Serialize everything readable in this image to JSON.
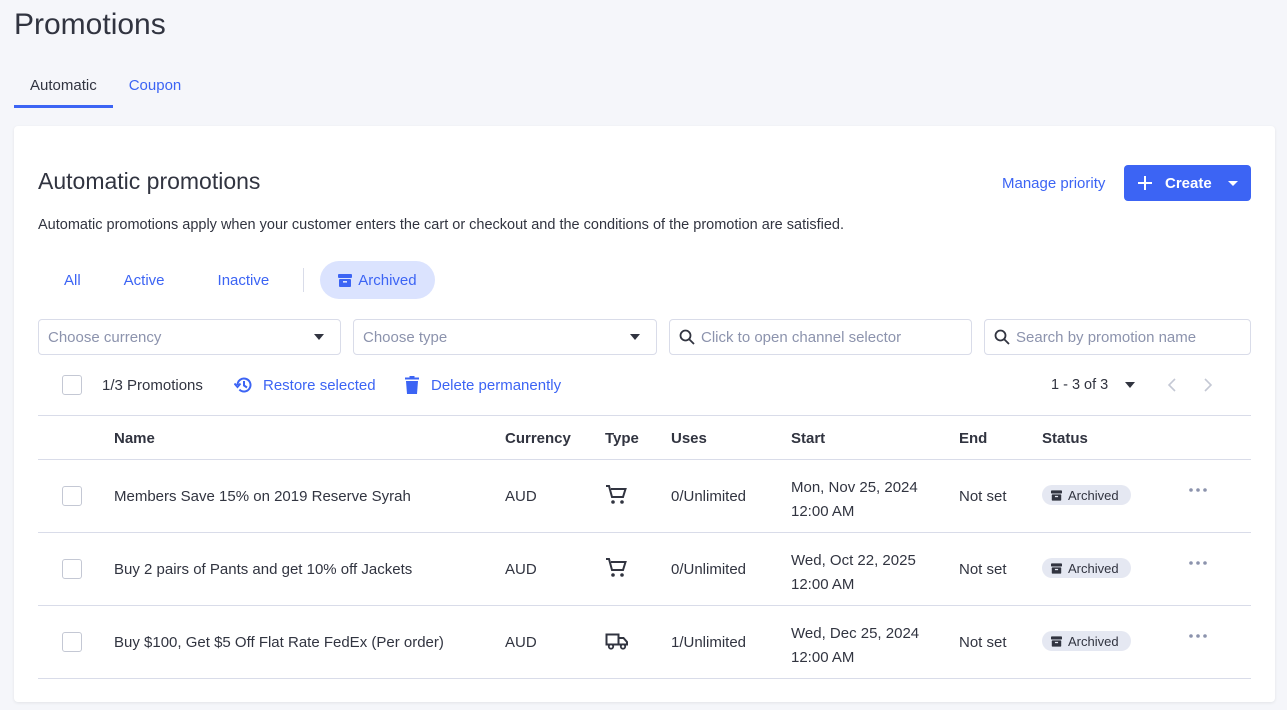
{
  "page": {
    "title": "Promotions"
  },
  "page_tabs": [
    {
      "label": "Automatic",
      "active": true
    },
    {
      "label": "Coupon",
      "active": false
    }
  ],
  "card": {
    "title": "Automatic promotions",
    "description": "Automatic promotions apply when your customer enters the cart or checkout and the conditions of the promotion are satisfied.",
    "manage_priority": "Manage priority",
    "create_label": "Create"
  },
  "filter_tabs": {
    "all": "All",
    "active": "Active",
    "inactive": "Inactive",
    "archived": "Archived"
  },
  "filters": {
    "currency_placeholder": "Choose currency",
    "type_placeholder": "Choose type",
    "channel_placeholder": "Click to open channel selector",
    "search_placeholder": "Search by promotion name"
  },
  "toolbar": {
    "count": "1/3 Promotions",
    "restore": "Restore selected",
    "delete": "Delete permanently",
    "pagination": "1 - 3 of 3"
  },
  "table": {
    "headers": {
      "name": "Name",
      "currency": "Currency",
      "type": "Type",
      "uses": "Uses",
      "start": "Start",
      "end": "End",
      "status": "Status"
    },
    "rows": [
      {
        "name": "Members Save 15% on 2019 Reserve Syrah",
        "currency": "AUD",
        "type_icon": "cart-icon",
        "uses": "0/Unlimited",
        "start_date": "Mon, Nov 25, 2024",
        "start_time": "12:00 AM",
        "end": "Not set",
        "status": "Archived"
      },
      {
        "name": "Buy 2 pairs of Pants and get 10% off Jackets",
        "currency": "AUD",
        "type_icon": "cart-icon",
        "uses": "0/Unlimited",
        "start_date": "Wed, Oct 22, 2025",
        "start_time": "12:00 AM",
        "end": "Not set",
        "status": "Archived"
      },
      {
        "name": "Buy $100, Get $5 Off Flat Rate FedEx (Per order)",
        "currency": "AUD",
        "type_icon": "truck-icon",
        "uses": "1/Unlimited",
        "start_date": "Wed, Dec 25, 2024",
        "start_time": "12:00 AM",
        "end": "Not set",
        "status": "Archived"
      }
    ]
  },
  "colors": {
    "accent": "#3c64f4",
    "archived_tab_bg": "#dbe3fe",
    "badge_bg": "#e5e8f2",
    "page_bg": "#f5f6fa",
    "text": "#313440"
  }
}
